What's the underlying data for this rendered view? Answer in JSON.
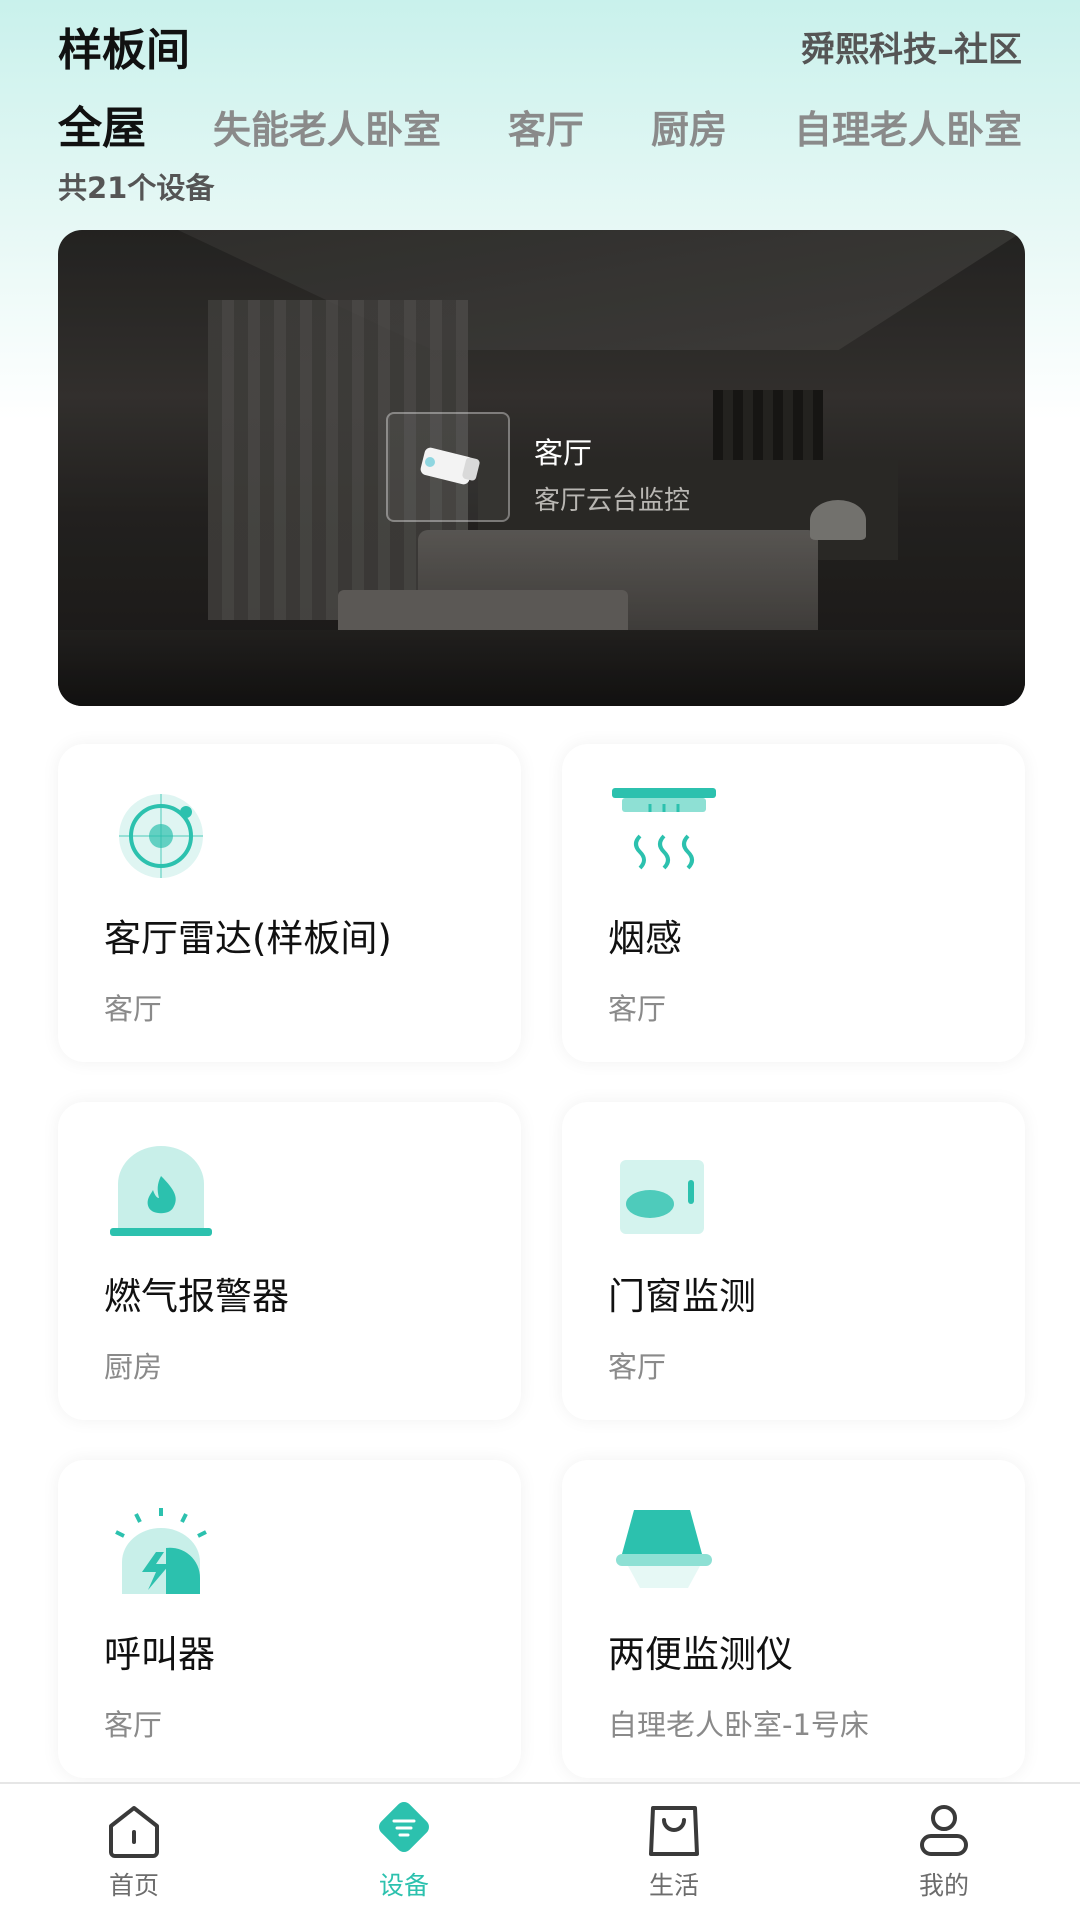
{
  "header": {
    "title": "样板间",
    "org": "舜熙科技–社区"
  },
  "tabs": [
    "全屋",
    "失能老人卧室",
    "客厅",
    "厨房",
    "自理老人卧室"
  ],
  "active_tab": "全屋",
  "device_count": "共21个设备",
  "banner": {
    "room": "客厅",
    "device": "客厅云台监控"
  },
  "devices": [
    {
      "name": "客厅雷达(样板间)",
      "location": "客厅",
      "icon": "radar-icon"
    },
    {
      "name": "烟感",
      "location": "客厅",
      "icon": "smoke-detector-icon"
    },
    {
      "name": "燃气报警器",
      "location": "厨房",
      "icon": "gas-alarm-icon"
    },
    {
      "name": "门窗监测",
      "location": "客厅",
      "icon": "door-window-sensor-icon"
    },
    {
      "name": "呼叫器",
      "location": "客厅",
      "icon": "call-button-icon"
    },
    {
      "name": "两便监测仪",
      "location": "自理老人卧室-1号床",
      "icon": "excretion-monitor-icon"
    }
  ],
  "nav": {
    "items": [
      {
        "label": "首页",
        "icon": "home-icon"
      },
      {
        "label": "设备",
        "icon": "device-icon"
      },
      {
        "label": "生活",
        "icon": "shopping-bag-icon"
      },
      {
        "label": "我的",
        "icon": "user-icon"
      }
    ],
    "active": "设备"
  },
  "colors": {
    "accent": "#2cc1ae",
    "header_gradient": "#c9f1ec",
    "text_primary": "#111111",
    "text_secondary": "#8a8a8a"
  }
}
